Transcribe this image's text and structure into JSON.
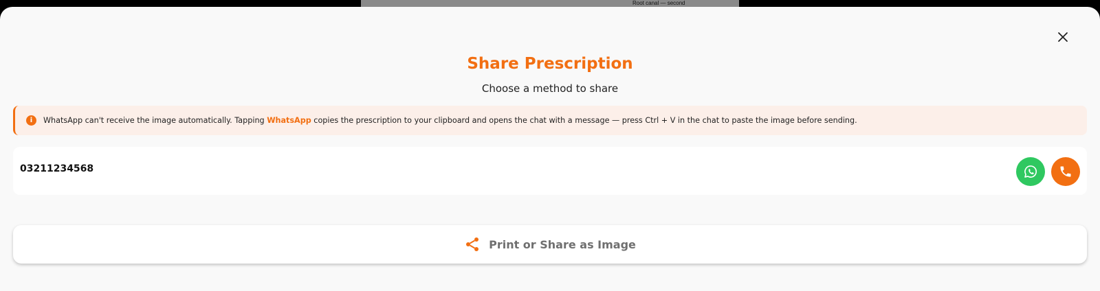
{
  "backdrop": {
    "caption": "Root canal — second"
  },
  "dialog": {
    "title": "Share Prescription",
    "subtitle": "Choose a method to share",
    "close_icon": "close-icon"
  },
  "notice": {
    "icon": "info-icon",
    "text_before": "WhatsApp can't receive the image automatically. Tapping ",
    "highlight": "WhatsApp",
    "text_after": " copies the prescription to your clipboard and opens the chat with a message — press Ctrl + V in the chat to paste the image before sending."
  },
  "contact": {
    "phone": "03211234568",
    "whatsapp_icon": "whatsapp-icon",
    "call_icon": "phone-icon"
  },
  "actions": {
    "print_share_label": "Print or Share as Image",
    "share_icon": "share-icon"
  },
  "colors": {
    "accent": "#f26f12",
    "whatsapp": "#2fc860",
    "notice_bg": "#fcefe9",
    "sheet_bg": "#f9f9f9"
  }
}
